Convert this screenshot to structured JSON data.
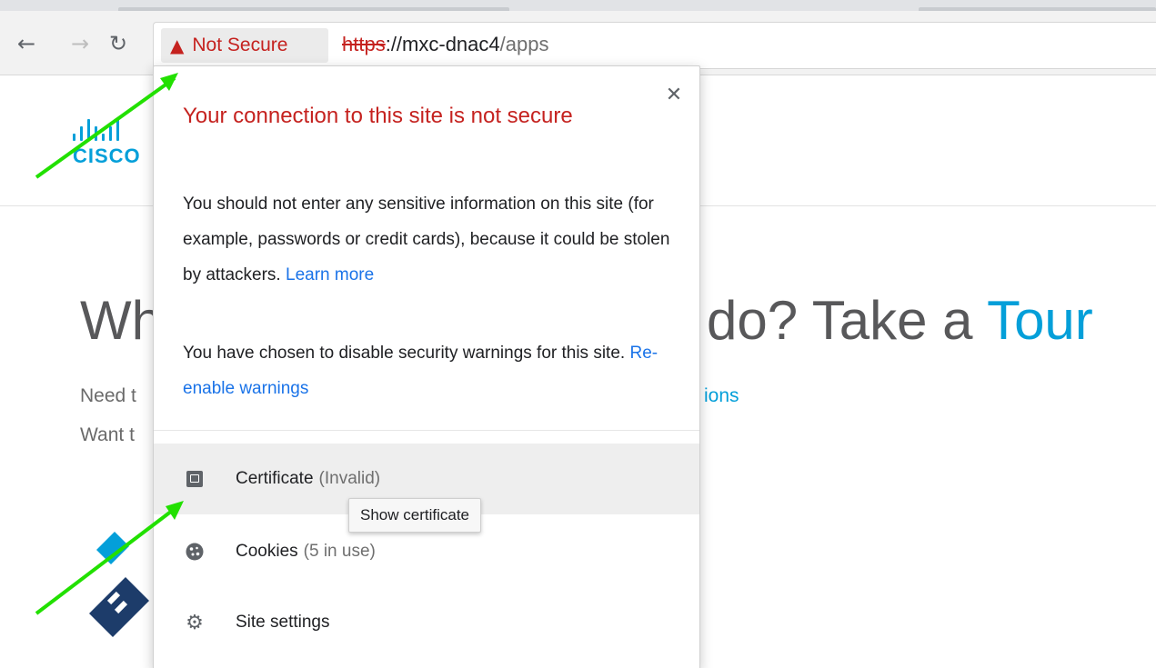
{
  "browser": {
    "back_icon": "back-arrow-icon",
    "forward_icon": "forward-arrow-icon",
    "reload_icon": "reload-icon",
    "security_chip_label": "Not Secure",
    "url": {
      "scheme": "https",
      "separator": "://",
      "host": "mxc-dnac4",
      "path": "/apps"
    }
  },
  "page": {
    "logo_word": "CISCO",
    "headline_left": "Wh",
    "headline_right_prefix": "do? Take a ",
    "headline_right_link": "Tour",
    "sub_line_1": "Need t",
    "sub_line_1_link": "ions",
    "sub_line_2": "Want t"
  },
  "popup": {
    "title": "Your connection to this site is not secure",
    "body_1": "You should not enter any sensitive information on this site (for example, passwords or credit cards), because it could be stolen by attackers. ",
    "body_1_link": "Learn more",
    "body_2": "You have chosen to disable security warnings for this site. ",
    "body_2_link": "Re-enable warnings",
    "items": [
      {
        "label": "Certificate",
        "secondary": "(Invalid)",
        "icon": "certificate-icon"
      },
      {
        "label": "Cookies",
        "secondary": "(5 in use)",
        "icon": "cookie-icon"
      },
      {
        "label": "Site settings",
        "secondary": "",
        "icon": "gear-icon"
      }
    ],
    "tooltip": "Show certificate"
  },
  "colors": {
    "danger": "#c5221f",
    "link": "#1a73e8",
    "cisco_blue": "#049fd9",
    "annotation_arrow": "#22e000"
  }
}
